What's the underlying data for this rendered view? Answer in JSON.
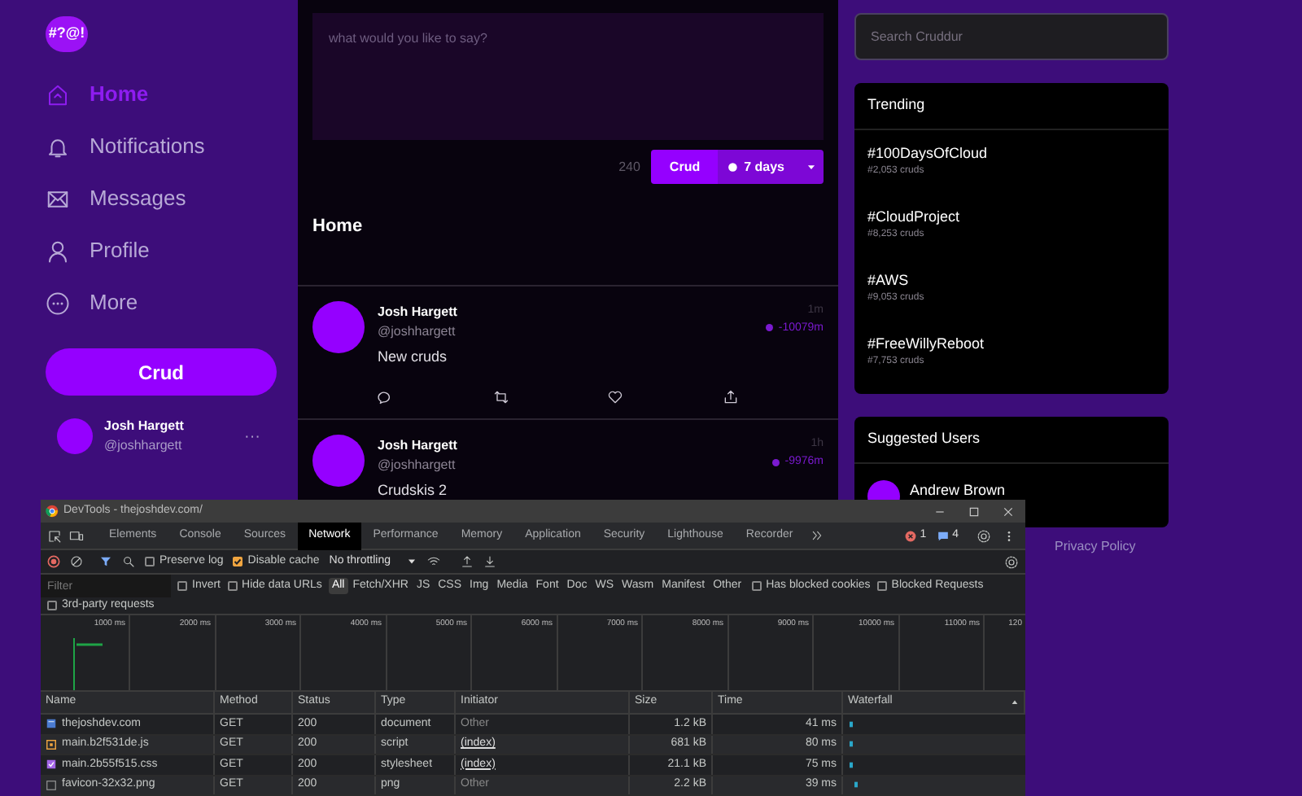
{
  "logo": "#?@!",
  "nav": [
    {
      "label": "Home",
      "kind": "home",
      "selected": true
    },
    {
      "label": "Notifications",
      "kind": "notifications",
      "selected": false
    },
    {
      "label": "Messages",
      "kind": "messages",
      "selected": false
    },
    {
      "label": "Profile",
      "kind": "profile",
      "selected": false
    },
    {
      "label": "More",
      "kind": "more",
      "selected": false
    }
  ],
  "crud_button": "Crud",
  "current_user": {
    "name": "Josh Hargett",
    "handle": "@joshhargett",
    "menu": "···"
  },
  "composer": {
    "placeholder": "what would you like to say?",
    "count": "240",
    "submit": "Crud",
    "ttl": "7 days"
  },
  "feed": {
    "title": "Home",
    "posts": [
      {
        "name": "Josh Hargett",
        "handle": "@joshhargett",
        "text": "New cruds",
        "time": "1m",
        "expires": "-10079m"
      },
      {
        "name": "Josh Hargett",
        "handle": "@joshhargett",
        "text": "Crudskis 2",
        "time": "1h",
        "expires": "-9976m"
      }
    ]
  },
  "search": {
    "placeholder": "Search Cruddur"
  },
  "trending": {
    "title": "Trending",
    "items": [
      {
        "tag": "#100DaysOfCloud",
        "count": "#2,053 cruds"
      },
      {
        "tag": "#CloudProject",
        "count": "#8,253 cruds"
      },
      {
        "tag": "#AWS",
        "count": "#9,053 cruds"
      },
      {
        "tag": "#FreeWillyReboot",
        "count": "#7,753 cruds"
      }
    ]
  },
  "suggested": {
    "title": "Suggested Users",
    "users": [
      {
        "name": "Andrew Brown"
      }
    ]
  },
  "footer_link": "Privacy Policy",
  "devtools": {
    "title": "DevTools - thejoshdev.com/",
    "tabs": [
      {
        "label": "Elements",
        "selected": false
      },
      {
        "label": "Console",
        "selected": false
      },
      {
        "label": "Sources",
        "selected": false
      },
      {
        "label": "Network",
        "selected": true
      },
      {
        "label": "Performance",
        "selected": false
      },
      {
        "label": "Memory",
        "selected": false
      },
      {
        "label": "Application",
        "selected": false
      },
      {
        "label": "Security",
        "selected": false
      },
      {
        "label": "Lighthouse",
        "selected": false
      },
      {
        "label": "Recorder",
        "selected": false
      }
    ],
    "errors": "1",
    "messages": "4",
    "preserve_log": {
      "label": "Preserve log",
      "checked": false
    },
    "disable_cache": {
      "label": "Disable cache",
      "checked": true
    },
    "throttling": "No throttling",
    "filter_placeholder": "Filter",
    "filter_checks": [
      {
        "label": "Invert",
        "checked": false
      },
      {
        "label": "Hide data URLs",
        "checked": false
      }
    ],
    "types": [
      {
        "label": "All",
        "selected": true
      },
      {
        "label": "Fetch/XHR",
        "selected": false
      },
      {
        "label": "JS",
        "selected": false
      },
      {
        "label": "CSS",
        "selected": false
      },
      {
        "label": "Img",
        "selected": false
      },
      {
        "label": "Media",
        "selected": false
      },
      {
        "label": "Font",
        "selected": false
      },
      {
        "label": "Doc",
        "selected": false
      },
      {
        "label": "WS",
        "selected": false
      },
      {
        "label": "Wasm",
        "selected": false
      },
      {
        "label": "Manifest",
        "selected": false
      },
      {
        "label": "Other",
        "selected": false
      }
    ],
    "blocked_checks": [
      {
        "label": "Has blocked cookies",
        "checked": false
      },
      {
        "label": "Blocked Requests",
        "checked": false
      }
    ],
    "third_party": {
      "label": "3rd-party requests",
      "checked": false
    },
    "ticks": [
      "1000 ms",
      "2000 ms",
      "3000 ms",
      "4000 ms",
      "5000 ms",
      "6000 ms",
      "7000 ms",
      "8000 ms",
      "9000 ms",
      "10000 ms",
      "11000 ms",
      "120"
    ],
    "columns": [
      "Name",
      "Method",
      "Status",
      "Type",
      "Initiator",
      "Size",
      "Time",
      "Waterfall"
    ],
    "rows": [
      {
        "kind": "document",
        "name": "thejoshdev.com",
        "method": "GET",
        "status": "200",
        "type": "document",
        "initiator": "Other",
        "initiator_link": false,
        "size": "1.2 kB",
        "time": "41 ms"
      },
      {
        "kind": "script",
        "name": "main.b2f531de.js",
        "method": "GET",
        "status": "200",
        "type": "script",
        "initiator": "(index)",
        "initiator_link": true,
        "size": "681 kB",
        "time": "80 ms"
      },
      {
        "kind": "stylesheet",
        "name": "main.2b55f515.css",
        "method": "GET",
        "status": "200",
        "type": "stylesheet",
        "initiator": "(index)",
        "initiator_link": true,
        "size": "21.1 kB",
        "time": "75 ms"
      },
      {
        "kind": "image",
        "name": "favicon-32x32.png",
        "method": "GET",
        "status": "200",
        "type": "png",
        "initiator": "Other",
        "initiator_link": false,
        "size": "2.2 kB",
        "time": "39 ms"
      }
    ]
  }
}
